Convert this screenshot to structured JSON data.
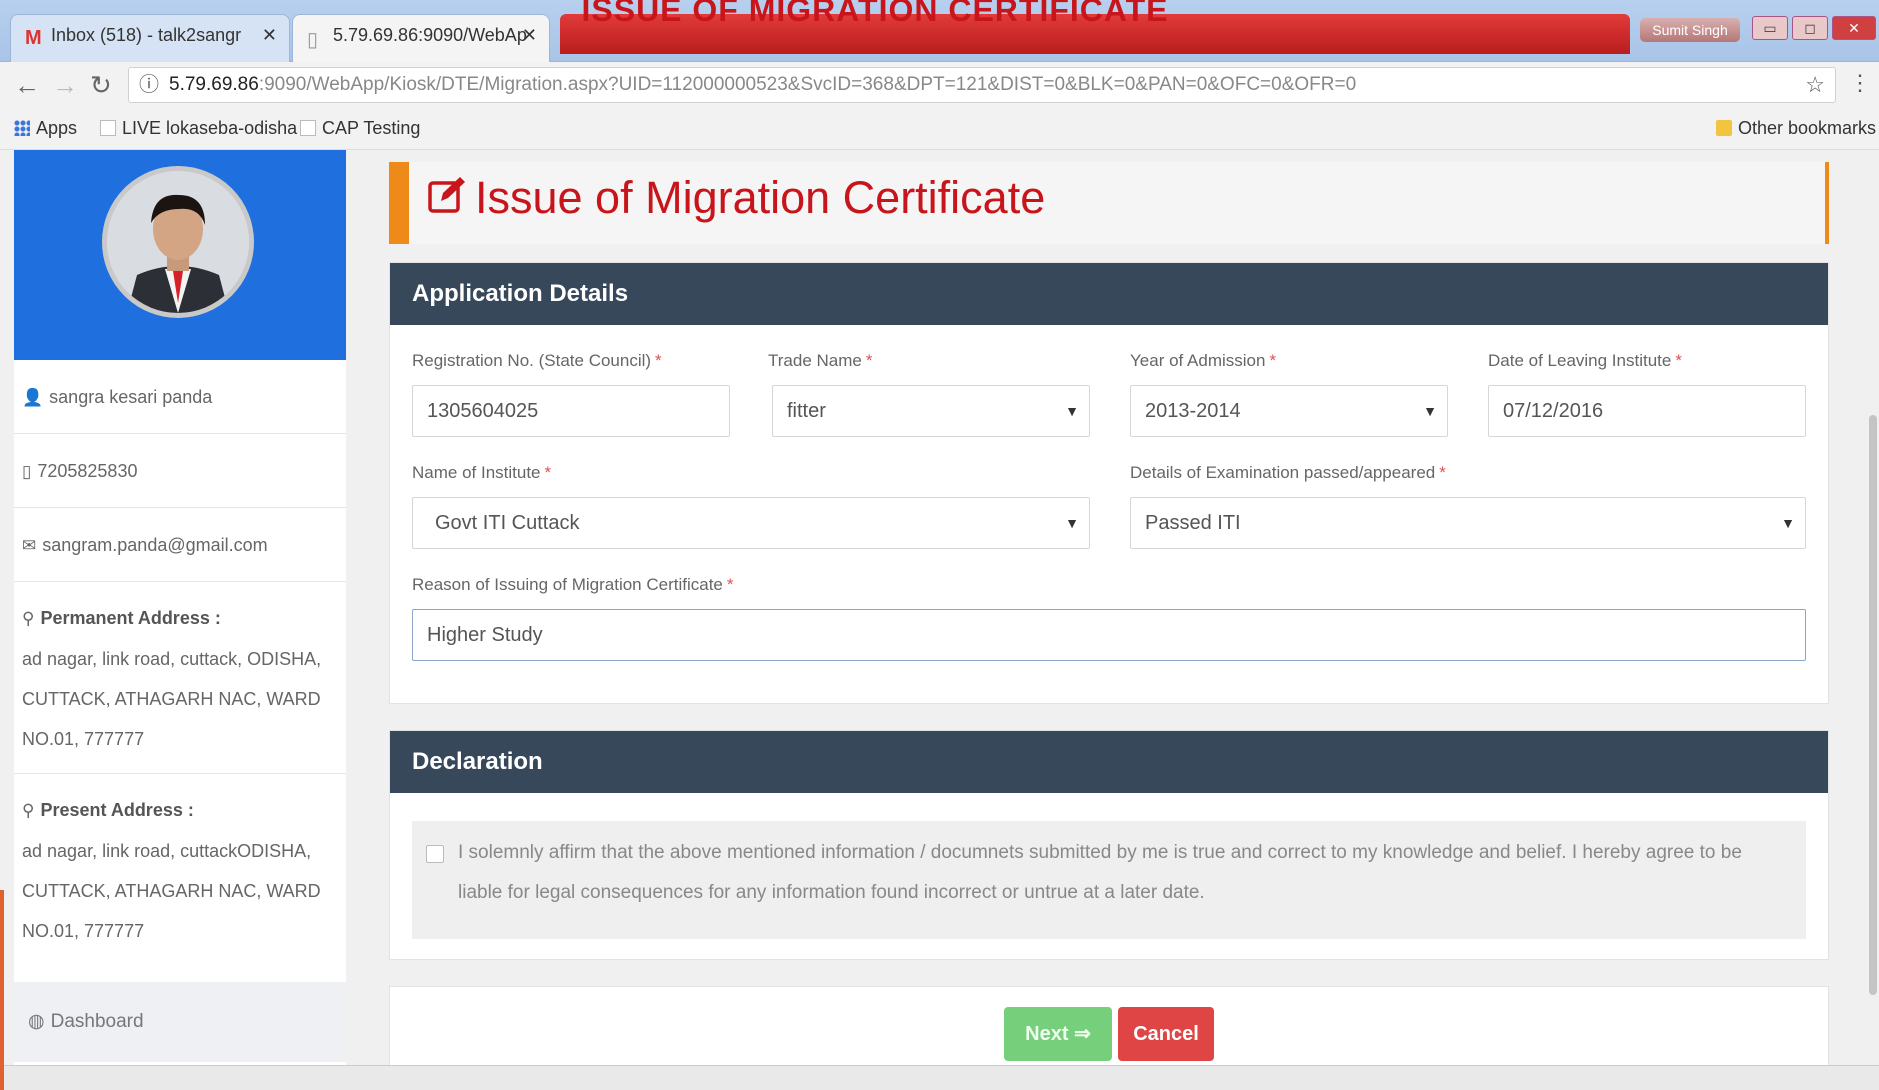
{
  "banner": "ISSUE OF MIGRATION CERTIFICATE",
  "browser": {
    "tabs": [
      {
        "label": "Inbox (518) - talk2sangr",
        "icon": "gmail-icon"
      },
      {
        "label": "5.79.69.86:9090/WebAp",
        "icon": "page-icon"
      }
    ],
    "user_chip": "Sumit Singh",
    "url_host": "5.79.69.86",
    "url_rest": ":9090/WebApp/Kiosk/DTE/Migration.aspx?UID=112000000523&SvcID=368&DPT=121&DIST=0&BLK=0&PAN=0&OFC=0&OFR=0",
    "bookmarks": [
      "Apps",
      "LIVE lokaseba-odisha",
      "CAP Testing"
    ],
    "other_bookmarks": "Other bookmarks"
  },
  "sidebar": {
    "name": "sangra kesari panda",
    "phone": "7205825830",
    "email": "sangram.panda@gmail.com",
    "permanent_title": "Permanent Address :",
    "permanent_lines": [
      "ad nagar, link road, cuttack, ODISHA,",
      "CUTTACK, ATHAGARH NAC, WARD",
      "NO.01, 777777"
    ],
    "present_title": "Present Address :",
    "present_lines": [
      "ad nagar, link road, cuttackODISHA,",
      "CUTTACK, ATHAGARH NAC, WARD",
      "NO.01, 777777"
    ],
    "dashboard": "Dashboard"
  },
  "page": {
    "title": "Issue of Migration Certificate",
    "accent": "#ee8a1a",
    "title_color": "#c8151b"
  },
  "application": {
    "heading": "Application Details",
    "fields": {
      "reg_label": "Registration No. (State Council)",
      "reg_value": "1305604025",
      "trade_label": "Trade Name",
      "trade_value": "fitter",
      "year_label": "Year of Admission",
      "year_value": "2013-2014",
      "leave_label": "Date of Leaving Institute",
      "leave_value": "07/12/2016",
      "inst_label": "Name of Institute",
      "inst_value": "Govt ITI Cuttack",
      "exam_label": "Details of Examination passed/appeared",
      "exam_value": "Passed ITI",
      "reason_label": "Reason of Issuing of Migration Certificate",
      "reason_value": "Higher Study"
    },
    "required_mark": "*"
  },
  "declaration": {
    "heading": "Declaration",
    "text": "I solemnly affirm that the above mentioned information / documnets submitted by me is true and correct to my knowledge and belief. I hereby agree to be liable for legal consequences for any information found incorrect or untrue at a later date."
  },
  "actions": {
    "next": "Next ⇒",
    "cancel": "Cancel"
  }
}
